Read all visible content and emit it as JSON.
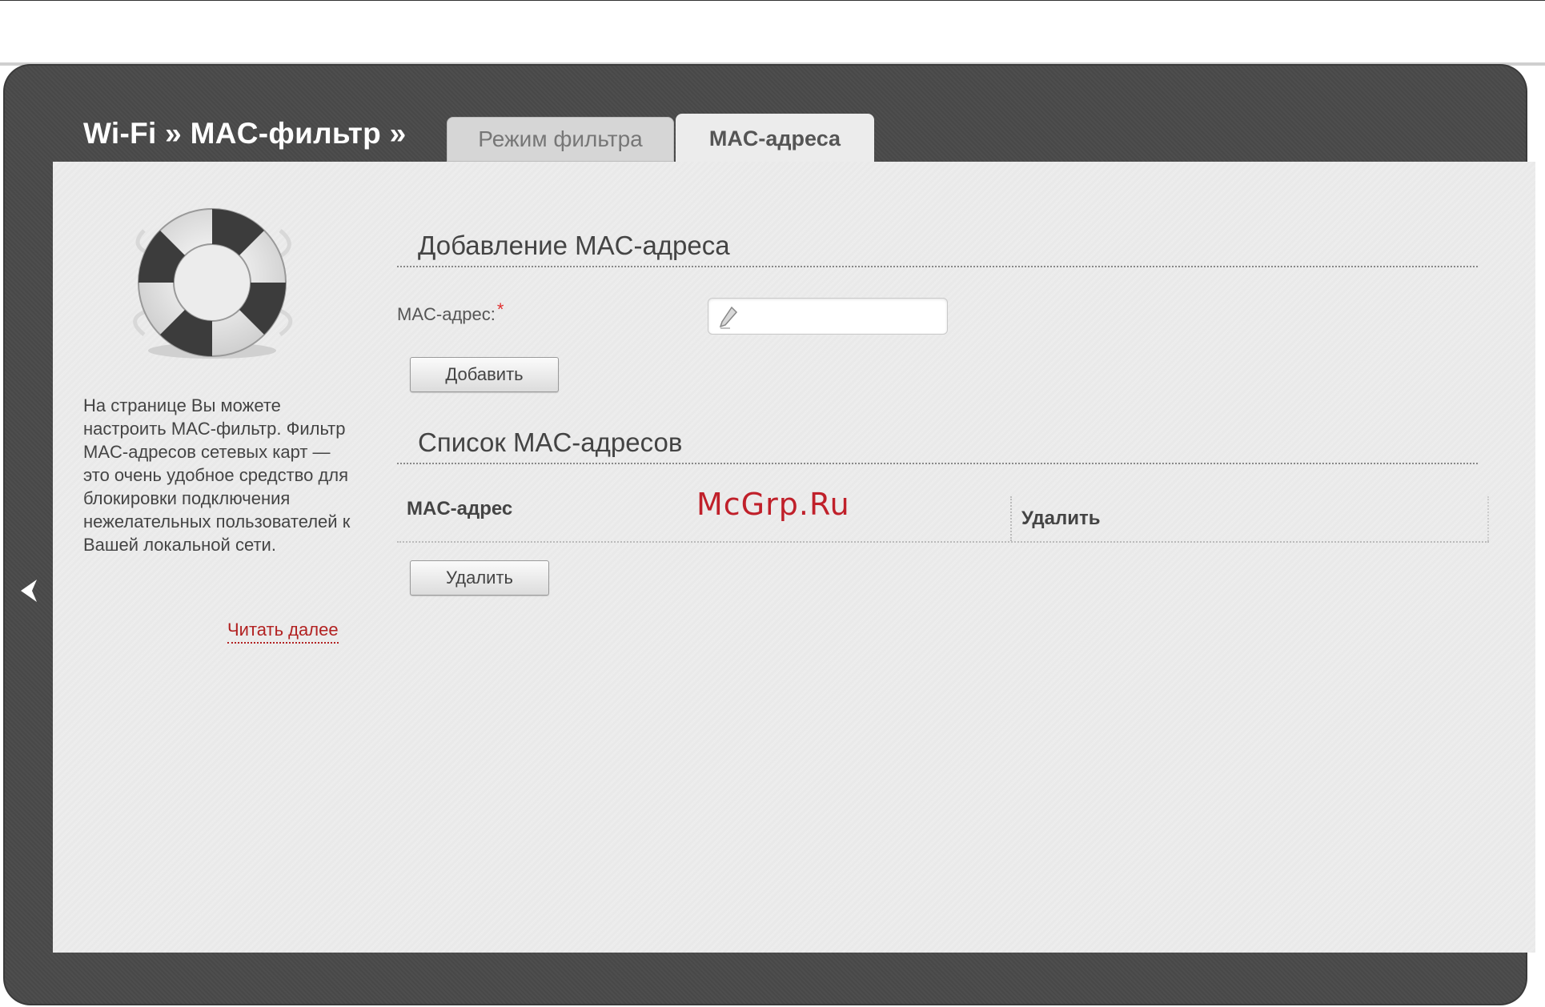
{
  "header": {
    "title": "Wi-Fi » MAC-фильтр »",
    "tabs": [
      {
        "label": "Режим фильтра",
        "active": false
      },
      {
        "label": "MAC-адреса",
        "active": true
      }
    ]
  },
  "sidebar": {
    "help_text": "На странице Вы можете настроить MAC-фильтр. Фильтр MAC-адресов сетевых карт — это очень удобное средство для блокировки подключения нежелательных пользователей к Вашей локальной сети.",
    "read_more": "Читать далее",
    "icon": "lifebuoy-icon"
  },
  "add_section": {
    "title": "Добавление MAC-адреса",
    "field_label": "MAC-адрес:",
    "required_mark": "*",
    "input_value": "",
    "add_button": "Добавить"
  },
  "list_section": {
    "title": "Список MAC-адресов",
    "columns": [
      "MAC-адрес",
      "Удалить"
    ],
    "rows": [],
    "delete_button": "Удалить"
  },
  "watermark": "McGrp.Ru",
  "colors": {
    "frame": "#4a4a4a",
    "panel": "#ececec",
    "link": "#b22222",
    "required": "#e03030",
    "watermark": "#c0202a"
  }
}
